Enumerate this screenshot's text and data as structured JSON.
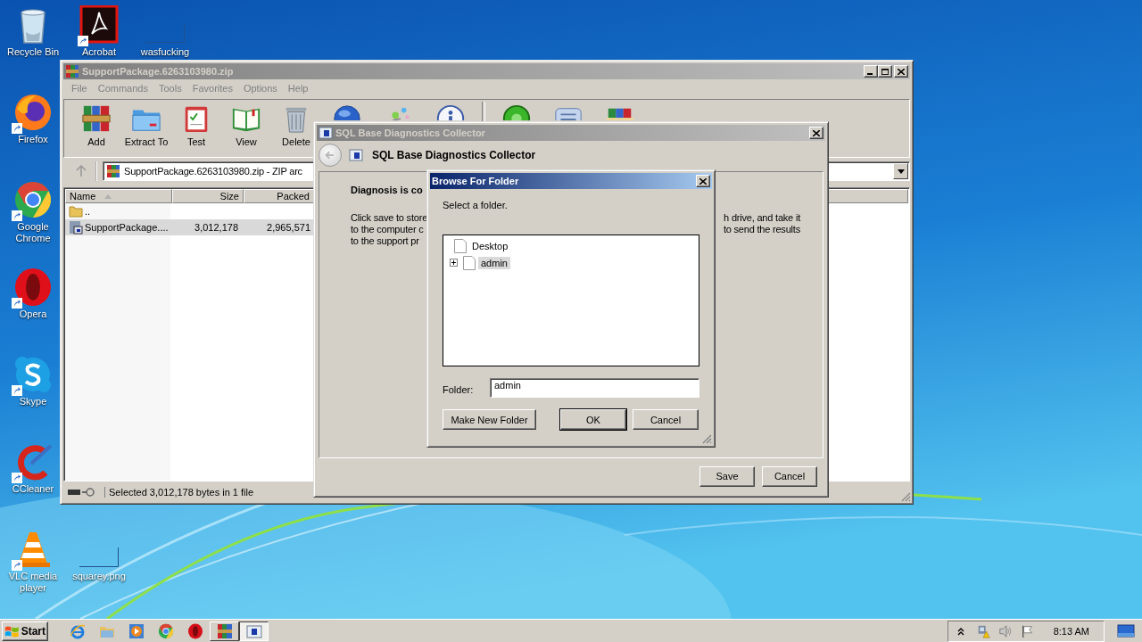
{
  "desktop_icons": [
    {
      "label": "Recycle Bin",
      "kind": "recycle-bin",
      "shortcut": false
    },
    {
      "label": "Acrobat",
      "kind": "acrobat",
      "shortcut": true
    },
    {
      "label": "wasfucking",
      "kind": "blank",
      "shortcut": false
    },
    {
      "label": "Firefox",
      "kind": "firefox",
      "shortcut": true
    },
    {
      "label": "Google Chrome",
      "kind": "chrome",
      "shortcut": true
    },
    {
      "label": "Opera",
      "kind": "opera",
      "shortcut": true
    },
    {
      "label": "Skype",
      "kind": "skype",
      "shortcut": true
    },
    {
      "label": "CCleaner",
      "kind": "ccleaner",
      "shortcut": true
    },
    {
      "label": "VLC media player",
      "kind": "vlc",
      "shortcut": true
    },
    {
      "label": "squarey.png",
      "kind": "blank",
      "shortcut": false
    }
  ],
  "archiver_window": {
    "title": "SupportPackage.6263103980.zip",
    "active": false,
    "menu": [
      "File",
      "Commands",
      "Tools",
      "Favorites",
      "Options",
      "Help"
    ],
    "toolbar": [
      {
        "label": "Add",
        "kind": "add"
      },
      {
        "label": "Extract To",
        "kind": "extract"
      },
      {
        "label": "Test",
        "kind": "test"
      },
      {
        "label": "View",
        "kind": "view"
      },
      {
        "label": "Delete",
        "kind": "delete"
      },
      {
        "kind": "globe"
      },
      {
        "kind": "wand"
      },
      {
        "kind": "info"
      },
      {
        "kind": "separator"
      },
      {
        "kind": "scan"
      },
      {
        "kind": "comment"
      },
      {
        "kind": "sfx"
      }
    ],
    "address": "SupportPackage.6263103980.zip - ZIP arc",
    "columns": [
      {
        "label": "Name",
        "sorted": true
      },
      {
        "label": "Size",
        "sorted": false
      },
      {
        "label": "Packed",
        "sorted": false
      }
    ],
    "rows": [
      {
        "kind": "parent",
        "name": "..",
        "selected": false
      },
      {
        "kind": "file",
        "name": "SupportPackage....",
        "size": "3,012,178",
        "packed": "2,965,571",
        "selected": true
      }
    ],
    "status": "Selected 3,012,178 bytes in 1 file"
  },
  "diagnostics_dialog": {
    "title": "SQL Base Diagnostics Collector",
    "active": false,
    "header": "SQL Base Diagnostics Collector",
    "heading": "Diagnosis is co",
    "text_lines": [
      {
        "visible_start": "Click save to store",
        "visible_end": "h drive, and take it"
      },
      {
        "visible_start": "to the computer c",
        "visible_end": "to send the results"
      },
      {
        "visible_start": "to the support pr"
      }
    ],
    "buttons": [
      "Save",
      "Cancel"
    ]
  },
  "browse_dialog": {
    "title": "Browse For Folder",
    "active": true,
    "prompt": "Select a folder.",
    "tree": [
      {
        "label": "Desktop",
        "selected": false,
        "children": [
          {
            "label": "admin",
            "selected": true,
            "expanded": false
          }
        ]
      }
    ],
    "folder_label": "Folder:",
    "folder_value": "admin",
    "buttons": [
      {
        "label": "Make New Folder",
        "default": false
      },
      {
        "label": "OK",
        "default": true
      },
      {
        "label": "Cancel",
        "default": false
      }
    ]
  },
  "taskbar": {
    "start": "Start",
    "buttons": [
      {
        "kind": "ie",
        "running": false,
        "selected": false
      },
      {
        "kind": "explorer",
        "running": false,
        "selected": false
      },
      {
        "kind": "media",
        "running": false,
        "selected": false
      },
      {
        "kind": "chrome",
        "running": false,
        "selected": false
      },
      {
        "kind": "opera",
        "running": false,
        "selected": false
      },
      {
        "kind": "winrar",
        "running": true,
        "selected": false
      },
      {
        "kind": "dialog",
        "running": true,
        "selected": true
      }
    ],
    "tray": [
      {
        "kind": "chevron"
      },
      {
        "kind": "network"
      },
      {
        "kind": "speaker"
      },
      {
        "kind": "flag"
      }
    ],
    "clock": "8:13 AM"
  }
}
